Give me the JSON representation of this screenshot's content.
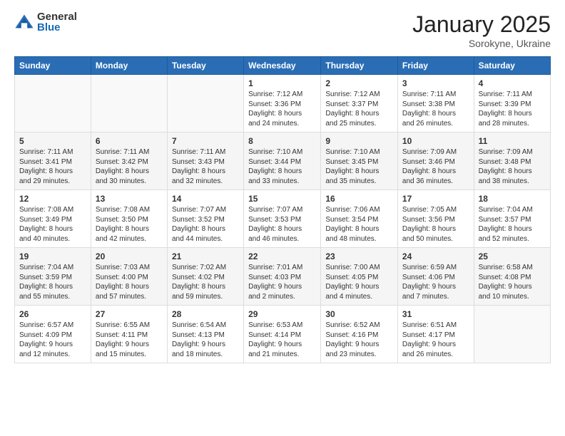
{
  "logo": {
    "general": "General",
    "blue": "Blue"
  },
  "header": {
    "month": "January 2025",
    "location": "Sorokyne, Ukraine"
  },
  "weekdays": [
    "Sunday",
    "Monday",
    "Tuesday",
    "Wednesday",
    "Thursday",
    "Friday",
    "Saturday"
  ],
  "weeks": [
    [
      {
        "day": "",
        "info": ""
      },
      {
        "day": "",
        "info": ""
      },
      {
        "day": "",
        "info": ""
      },
      {
        "day": "1",
        "info": "Sunrise: 7:12 AM\nSunset: 3:36 PM\nDaylight: 8 hours\nand 24 minutes."
      },
      {
        "day": "2",
        "info": "Sunrise: 7:12 AM\nSunset: 3:37 PM\nDaylight: 8 hours\nand 25 minutes."
      },
      {
        "day": "3",
        "info": "Sunrise: 7:11 AM\nSunset: 3:38 PM\nDaylight: 8 hours\nand 26 minutes."
      },
      {
        "day": "4",
        "info": "Sunrise: 7:11 AM\nSunset: 3:39 PM\nDaylight: 8 hours\nand 28 minutes."
      }
    ],
    [
      {
        "day": "5",
        "info": "Sunrise: 7:11 AM\nSunset: 3:41 PM\nDaylight: 8 hours\nand 29 minutes."
      },
      {
        "day": "6",
        "info": "Sunrise: 7:11 AM\nSunset: 3:42 PM\nDaylight: 8 hours\nand 30 minutes."
      },
      {
        "day": "7",
        "info": "Sunrise: 7:11 AM\nSunset: 3:43 PM\nDaylight: 8 hours\nand 32 minutes."
      },
      {
        "day": "8",
        "info": "Sunrise: 7:10 AM\nSunset: 3:44 PM\nDaylight: 8 hours\nand 33 minutes."
      },
      {
        "day": "9",
        "info": "Sunrise: 7:10 AM\nSunset: 3:45 PM\nDaylight: 8 hours\nand 35 minutes."
      },
      {
        "day": "10",
        "info": "Sunrise: 7:09 AM\nSunset: 3:46 PM\nDaylight: 8 hours\nand 36 minutes."
      },
      {
        "day": "11",
        "info": "Sunrise: 7:09 AM\nSunset: 3:48 PM\nDaylight: 8 hours\nand 38 minutes."
      }
    ],
    [
      {
        "day": "12",
        "info": "Sunrise: 7:08 AM\nSunset: 3:49 PM\nDaylight: 8 hours\nand 40 minutes."
      },
      {
        "day": "13",
        "info": "Sunrise: 7:08 AM\nSunset: 3:50 PM\nDaylight: 8 hours\nand 42 minutes."
      },
      {
        "day": "14",
        "info": "Sunrise: 7:07 AM\nSunset: 3:52 PM\nDaylight: 8 hours\nand 44 minutes."
      },
      {
        "day": "15",
        "info": "Sunrise: 7:07 AM\nSunset: 3:53 PM\nDaylight: 8 hours\nand 46 minutes."
      },
      {
        "day": "16",
        "info": "Sunrise: 7:06 AM\nSunset: 3:54 PM\nDaylight: 8 hours\nand 48 minutes."
      },
      {
        "day": "17",
        "info": "Sunrise: 7:05 AM\nSunset: 3:56 PM\nDaylight: 8 hours\nand 50 minutes."
      },
      {
        "day": "18",
        "info": "Sunrise: 7:04 AM\nSunset: 3:57 PM\nDaylight: 8 hours\nand 52 minutes."
      }
    ],
    [
      {
        "day": "19",
        "info": "Sunrise: 7:04 AM\nSunset: 3:59 PM\nDaylight: 8 hours\nand 55 minutes."
      },
      {
        "day": "20",
        "info": "Sunrise: 7:03 AM\nSunset: 4:00 PM\nDaylight: 8 hours\nand 57 minutes."
      },
      {
        "day": "21",
        "info": "Sunrise: 7:02 AM\nSunset: 4:02 PM\nDaylight: 8 hours\nand 59 minutes."
      },
      {
        "day": "22",
        "info": "Sunrise: 7:01 AM\nSunset: 4:03 PM\nDaylight: 9 hours\nand 2 minutes."
      },
      {
        "day": "23",
        "info": "Sunrise: 7:00 AM\nSunset: 4:05 PM\nDaylight: 9 hours\nand 4 minutes."
      },
      {
        "day": "24",
        "info": "Sunrise: 6:59 AM\nSunset: 4:06 PM\nDaylight: 9 hours\nand 7 minutes."
      },
      {
        "day": "25",
        "info": "Sunrise: 6:58 AM\nSunset: 4:08 PM\nDaylight: 9 hours\nand 10 minutes."
      }
    ],
    [
      {
        "day": "26",
        "info": "Sunrise: 6:57 AM\nSunset: 4:09 PM\nDaylight: 9 hours\nand 12 minutes."
      },
      {
        "day": "27",
        "info": "Sunrise: 6:55 AM\nSunset: 4:11 PM\nDaylight: 9 hours\nand 15 minutes."
      },
      {
        "day": "28",
        "info": "Sunrise: 6:54 AM\nSunset: 4:13 PM\nDaylight: 9 hours\nand 18 minutes."
      },
      {
        "day": "29",
        "info": "Sunrise: 6:53 AM\nSunset: 4:14 PM\nDaylight: 9 hours\nand 21 minutes."
      },
      {
        "day": "30",
        "info": "Sunrise: 6:52 AM\nSunset: 4:16 PM\nDaylight: 9 hours\nand 23 minutes."
      },
      {
        "day": "31",
        "info": "Sunrise: 6:51 AM\nSunset: 4:17 PM\nDaylight: 9 hours\nand 26 minutes."
      },
      {
        "day": "",
        "info": ""
      }
    ]
  ]
}
